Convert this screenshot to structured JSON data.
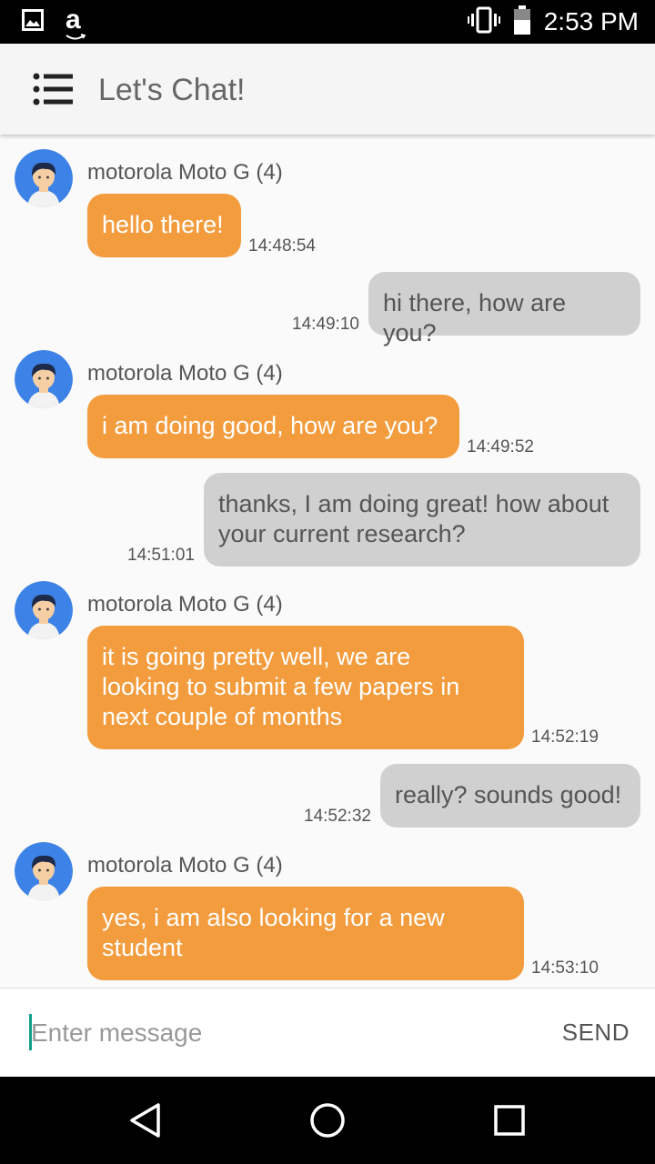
{
  "status_bar": {
    "time": "2:53 PM",
    "icons": [
      "image-icon",
      "amazon-icon",
      "vibrate-icon",
      "battery-icon"
    ],
    "amazon_letter": "a"
  },
  "app_bar": {
    "title": "Let's Chat!",
    "menu_icon": "menu-icon"
  },
  "messages": [
    {
      "direction": "incoming",
      "sender": "motorola Moto G (4)",
      "lines": [
        "hello there!"
      ],
      "time": "14:48:54"
    },
    {
      "direction": "outgoing",
      "lines": [
        "hi there, how are you?"
      ],
      "time": "14:49:10"
    },
    {
      "direction": "incoming",
      "sender": "motorola Moto G (4)",
      "lines": [
        "i am doing good, how are you?"
      ],
      "time": "14:49:52"
    },
    {
      "direction": "outgoing",
      "lines": [
        "thanks, I am doing great! how about",
        "your current research?"
      ],
      "time": "14:51:01"
    },
    {
      "direction": "incoming",
      "sender": "motorola Moto G (4)",
      "lines": [
        "it is going pretty well, we are",
        "looking to submit a few papers in",
        "next couple of months"
      ],
      "time": "14:52:19"
    },
    {
      "direction": "outgoing",
      "lines": [
        "really? sounds good!"
      ],
      "time": "14:52:32"
    },
    {
      "direction": "incoming",
      "sender": "motorola Moto G (4)",
      "lines": [
        "yes, i am also looking for a new",
        "student"
      ],
      "time": "14:53:10"
    }
  ],
  "input": {
    "placeholder": "Enter message",
    "value": "",
    "send_label": "SEND"
  },
  "nav_bar": {
    "icons": [
      "back-icon",
      "home-icon",
      "recents-icon"
    ]
  },
  "colors": {
    "incoming_bubble": "#f39c3d",
    "outgoing_bubble": "#d0d0d0",
    "cursor": "#119e8a",
    "avatar_bg": "#3d82e6"
  }
}
